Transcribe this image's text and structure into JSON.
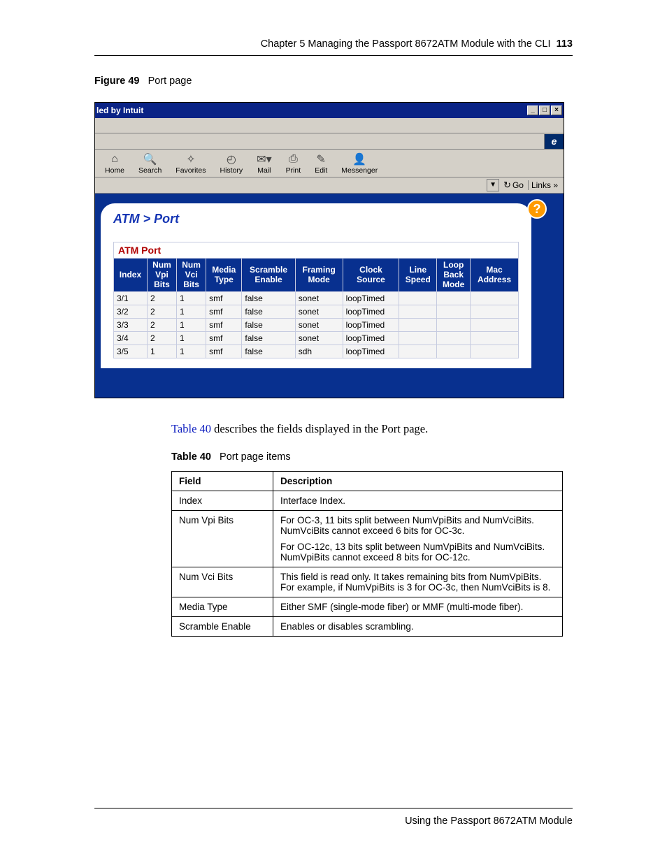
{
  "header": {
    "chapter": "Chapter 5  Managing the Passport 8672ATM Module with the CLI",
    "page_number": "113"
  },
  "figure": {
    "label": "Figure 49",
    "title": "Port page"
  },
  "screenshot": {
    "titlebar": "led by Intuit",
    "toolbar": [
      {
        "icon": "⌂",
        "label": "Home"
      },
      {
        "icon": "🔍",
        "label": "Search"
      },
      {
        "icon": "✧",
        "label": "Favorites"
      },
      {
        "icon": "◴",
        "label": "History"
      },
      {
        "icon": "✉▾",
        "label": "Mail"
      },
      {
        "icon": "⎙",
        "label": "Print"
      },
      {
        "icon": "✎",
        "label": "Edit"
      },
      {
        "icon": "👤",
        "label": "Messenger"
      }
    ],
    "go_label": "Go",
    "links_label": "Links »",
    "breadcrumb": "ATM > Port",
    "panel_title": "ATM Port",
    "table": {
      "headers": [
        "Index",
        "Num Vpi Bits",
        "Num Vci Bits",
        "Media Type",
        "Scramble Enable",
        "Framing Mode",
        "Clock Source",
        "Line Speed",
        "Loop Back Mode",
        "Mac Address"
      ],
      "rows": [
        [
          "3/1",
          "2",
          "1",
          "smf",
          "false",
          "sonet",
          "loopTimed",
          "",
          "",
          ""
        ],
        [
          "3/2",
          "2",
          "1",
          "smf",
          "false",
          "sonet",
          "loopTimed",
          "",
          "",
          ""
        ],
        [
          "3/3",
          "2",
          "1",
          "smf",
          "false",
          "sonet",
          "loopTimed",
          "",
          "",
          ""
        ],
        [
          "3/4",
          "2",
          "1",
          "smf",
          "false",
          "sonet",
          "loopTimed",
          "",
          "",
          ""
        ],
        [
          "3/5",
          "1",
          "1",
          "smf",
          "false",
          "sdh",
          "loopTimed",
          "",
          "",
          ""
        ]
      ]
    }
  },
  "body_para": {
    "link": "Table 40",
    "rest": " describes the fields displayed in the Port page."
  },
  "table40": {
    "label": "Table 40",
    "title": "Port page items",
    "head_field": "Field",
    "head_desc": "Description",
    "rows": [
      {
        "field": "Index",
        "desc": [
          "Interface Index."
        ]
      },
      {
        "field": "Num Vpi Bits",
        "desc": [
          "For OC-3, 11 bits split between NumVpiBits and NumVciBits. NumVciBits cannot exceed 6 bits for OC-3c.",
          "For OC-12c, 13 bits split between NumVpiBits and NumVciBits. NumVpiBits cannot exceed 8 bits for OC-12c."
        ]
      },
      {
        "field": "Num Vci Bits",
        "desc": [
          "This field is read only. It takes remaining bits from NumVpiBits. For example, if NumVpiBits is 3 for OC-3c, then NumVciBits is 8."
        ]
      },
      {
        "field": "Media Type",
        "desc": [
          "Either SMF (single-mode fiber) or MMF (multi-mode fiber)."
        ]
      },
      {
        "field": "Scramble Enable",
        "desc": [
          "Enables or disables scrambling."
        ]
      }
    ]
  },
  "footer": "Using the Passport 8672ATM Module"
}
